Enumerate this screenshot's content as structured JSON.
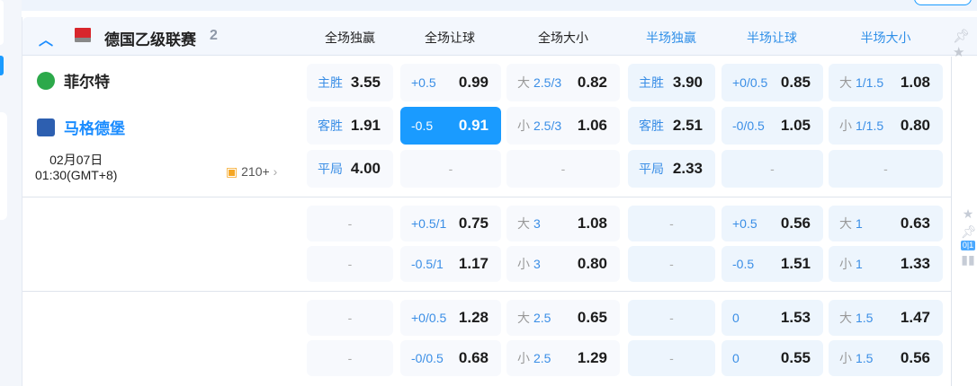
{
  "league": {
    "name": "德国乙级联赛",
    "count": "2",
    "collapse_icon": "chevron-up-icon"
  },
  "columns": [
    "全场独赢",
    "全场让球",
    "全场大小",
    "半场独赢",
    "半场让球",
    "半场大小"
  ],
  "match": {
    "home": "菲尔特",
    "away": "马格德堡",
    "date": "02月07日",
    "time": "01:30(GMT+8)",
    "more_markets": "210+"
  },
  "colors": {
    "accent": "#1a9bff",
    "selected_bg": "#1a9bff"
  },
  "groups": [
    [
      [
        {
          "l": "主胜",
          "o": "3.55"
        },
        {
          "l": "+0.5",
          "o": "0.99"
        },
        {
          "p": "大",
          "l": "2.5/3",
          "o": "0.82"
        },
        {
          "l": "主胜",
          "o": "3.90"
        },
        {
          "l": "+0/0.5",
          "o": "0.85"
        },
        {
          "p": "大",
          "l": "1/1.5",
          "o": "1.08"
        }
      ],
      [
        {
          "l": "客胜",
          "o": "1.91"
        },
        {
          "l": "-0.5",
          "o": "0.91",
          "selected": true
        },
        {
          "p": "小",
          "l": "2.5/3",
          "o": "1.06"
        },
        {
          "l": "客胜",
          "o": "2.51"
        },
        {
          "l": "-0/0.5",
          "o": "1.05"
        },
        {
          "p": "小",
          "l": "1/1.5",
          "o": "0.80"
        }
      ],
      [
        {
          "l": "平局",
          "o": "4.00"
        },
        null,
        null,
        {
          "l": "平局",
          "o": "2.33"
        },
        null,
        null
      ]
    ],
    [
      [
        null,
        {
          "l": "+0.5/1",
          "o": "0.75"
        },
        {
          "p": "大",
          "l": "3",
          "o": "1.08"
        },
        null,
        {
          "l": "+0.5",
          "o": "0.56"
        },
        {
          "p": "大",
          "l": "1",
          "o": "0.63"
        }
      ],
      [
        null,
        {
          "l": "-0.5/1",
          "o": "1.17"
        },
        {
          "p": "小",
          "l": "3",
          "o": "0.80"
        },
        null,
        {
          "l": "-0.5",
          "o": "1.51"
        },
        {
          "p": "小",
          "l": "1",
          "o": "1.33"
        }
      ]
    ],
    [
      [
        null,
        {
          "l": "+0/0.5",
          "o": "1.28"
        },
        {
          "p": "大",
          "l": "2.5",
          "o": "0.65"
        },
        null,
        {
          "l": "0",
          "o": "1.53"
        },
        {
          "p": "大",
          "l": "1.5",
          "o": "1.47"
        }
      ],
      [
        null,
        {
          "l": "-0/0.5",
          "o": "0.68"
        },
        {
          "p": "小",
          "l": "2.5",
          "o": "1.29"
        },
        null,
        {
          "l": "0",
          "o": "0.55"
        },
        {
          "p": "小",
          "l": "1.5",
          "o": "0.56"
        }
      ]
    ]
  ],
  "dash": "-"
}
